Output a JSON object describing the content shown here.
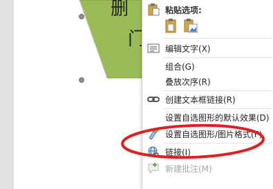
{
  "document": {
    "shape_text_top": "删",
    "shape_text_mid": "门",
    "shape_fill": "#9bbb59",
    "handle_color": "#8d8d8d"
  },
  "menu": {
    "header": "粘贴选项:",
    "paste_icons": [
      "clipboard-icon",
      "clipboard-picture-icon"
    ],
    "items": [
      {
        "label": "编辑文字(X)",
        "icon": "edit-text-icon",
        "enabled": true
      },
      {
        "label": "组合(G)",
        "icon": "",
        "enabled": true
      },
      {
        "label": "叠放次序(R)",
        "icon": "",
        "enabled": true
      },
      {
        "label": "创建文本框链接(R)",
        "icon": "link-chain-icon",
        "enabled": true
      },
      {
        "label": "设置自选图形的默认效果(D)",
        "icon": "",
        "enabled": true
      },
      {
        "label": "设置自选图形/图片格式(F)",
        "icon": "format-shape-icon",
        "enabled": true
      },
      {
        "label": "链接(I)",
        "icon": "hyperlink-globe-icon",
        "enabled": true
      },
      {
        "label": "新建批注(M)",
        "icon": "new-comment-icon",
        "enabled": false
      }
    ]
  },
  "annotation": {
    "ellipse_color": "#e02020"
  }
}
